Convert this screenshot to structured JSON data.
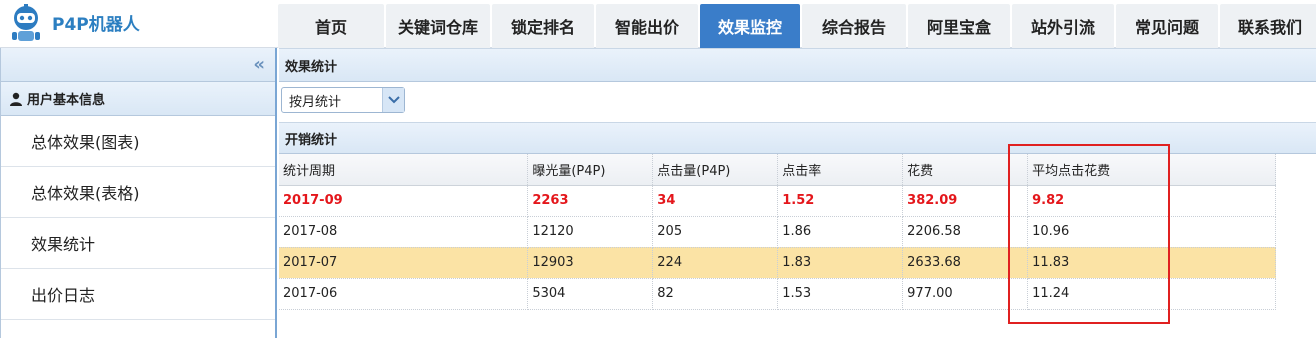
{
  "brand": {
    "name": "P4P机器人"
  },
  "nav": [
    {
      "label": "首页",
      "active": false
    },
    {
      "label": "关键词仓库",
      "active": false
    },
    {
      "label": "锁定排名",
      "active": false
    },
    {
      "label": "智能出价",
      "active": false
    },
    {
      "label": "效果监控",
      "active": true
    },
    {
      "label": "综合报告",
      "active": false
    },
    {
      "label": "阿里宝盒",
      "active": false
    },
    {
      "label": "站外引流",
      "active": false
    },
    {
      "label": "常见问题",
      "active": false
    },
    {
      "label": "联系我们",
      "active": false
    }
  ],
  "sidebar": {
    "collapse_glyph": "«",
    "header": "用户基本信息",
    "items": [
      {
        "label": "总体效果(图表)"
      },
      {
        "label": "总体效果(表格)"
      },
      {
        "label": "效果统计"
      },
      {
        "label": "出价日志"
      }
    ]
  },
  "main": {
    "panel_title": "效果统计",
    "period_select": {
      "value": "按月统计"
    },
    "table_title": "开销统计",
    "columns": [
      "统计周期",
      "曝光量(P4P)",
      "点击量(P4P)",
      "点击率",
      "花费",
      "平均点击花费"
    ],
    "rows": [
      [
        "2017-09",
        "2263",
        "34",
        "1.52",
        "382.09",
        "9.82"
      ],
      [
        "2017-08",
        "12120",
        "205",
        "1.86",
        "2206.58",
        "10.96"
      ],
      [
        "2017-07",
        "12903",
        "224",
        "1.83",
        "2633.68",
        "11.83"
      ],
      [
        "2017-06",
        "5304",
        "82",
        "1.53",
        "977.00",
        "11.24"
      ]
    ]
  },
  "colors": {
    "accent": "#3a7dc9",
    "highlight_text": "#e4161b",
    "stripe": "#fbe3a5",
    "annotation_box": "#e02020"
  }
}
